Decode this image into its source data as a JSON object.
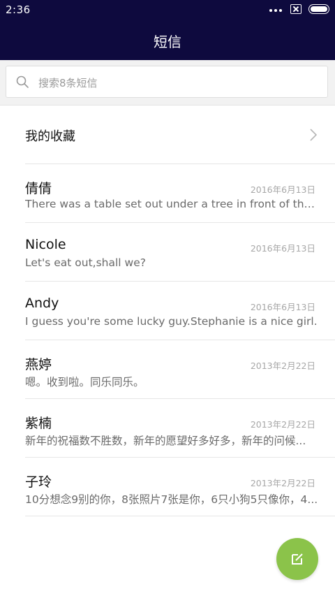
{
  "status_bar": {
    "time": "2:36"
  },
  "header": {
    "title": "短信"
  },
  "search": {
    "placeholder": "搜索8条短信"
  },
  "favorites": {
    "label": "我的收藏"
  },
  "messages": [
    {
      "name": "倩倩",
      "date": "2016年6月13日",
      "preview": "There was a table set out under a tree in front of the ho..."
    },
    {
      "name": "Nicole",
      "date": "2016年6月13日",
      "preview": "Let's eat out,shall we?"
    },
    {
      "name": "Andy",
      "date": "2016年6月13日",
      "preview": "I guess you're some lucky guy.Stephanie is a nice girl."
    },
    {
      "name": "燕婷",
      "date": "2013年2月22日",
      "preview": "嗯。收到啦。同乐同乐。"
    },
    {
      "name": "紫楠",
      "date": "2013年2月22日",
      "preview": "新年的祝福数不胜数，新年的愿望好多好多，新年的问候..."
    },
    {
      "name": "子玲",
      "date": "2013年2月22日",
      "preview": "10分想念9别的你，8张照片7张是你，6只小狗5只像你，4..."
    }
  ],
  "colors": {
    "header_bg": "#0e0a3e",
    "fab_bg": "#8bc34a"
  },
  "icons": {
    "search": "search-icon",
    "chevron": "chevron-right-icon",
    "compose": "compose-icon"
  }
}
